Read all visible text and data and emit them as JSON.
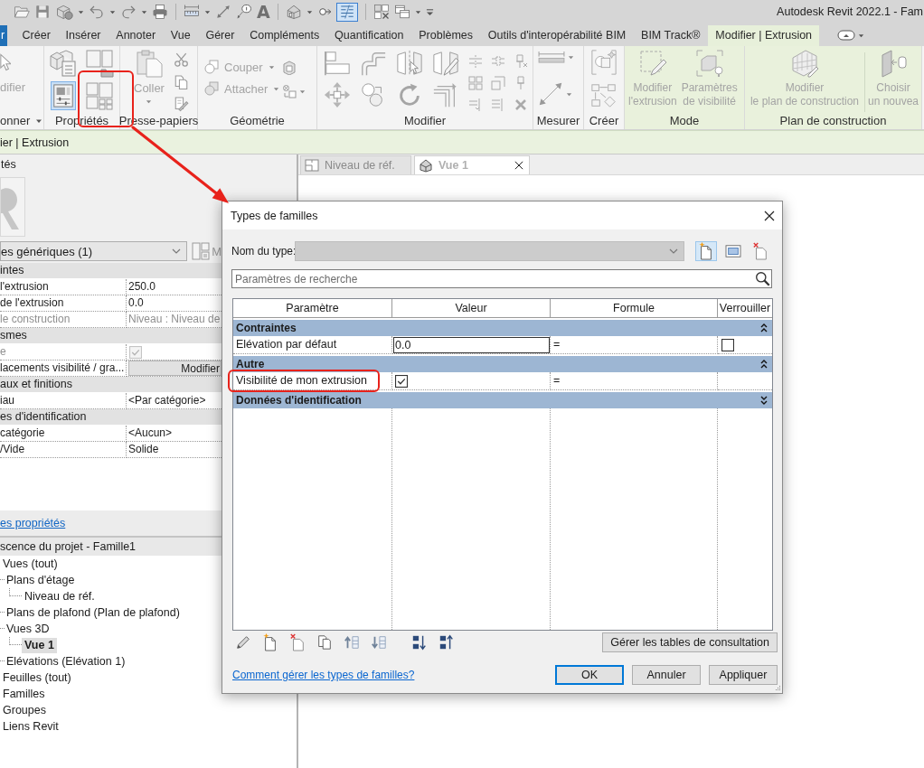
{
  "app_title": "Autodesk Revit 2022.1 - Fam",
  "quick_access": {
    "text_tool": "A",
    "thin_lines_on": true
  },
  "ribbon_tabs": [
    {
      "label": "r",
      "kind": "file",
      "selected": false
    },
    {
      "label": "Créer",
      "kind": "tab",
      "selected": false
    },
    {
      "label": "Insérer",
      "kind": "tab",
      "selected": false
    },
    {
      "label": "Annoter",
      "kind": "tab",
      "selected": false
    },
    {
      "label": "Vue",
      "kind": "tab",
      "selected": false
    },
    {
      "label": "Gérer",
      "kind": "tab",
      "selected": false
    },
    {
      "label": "Compléments",
      "kind": "tab",
      "selected": false
    },
    {
      "label": "Quantification",
      "kind": "tab",
      "selected": false
    },
    {
      "label": "Problèmes",
      "kind": "tab",
      "selected": false
    },
    {
      "label": "Outils d'interopérabilité BIM",
      "kind": "tab",
      "selected": false
    },
    {
      "label": "BIM Track®",
      "kind": "tab",
      "selected": false
    },
    {
      "label": "Modifier | Extrusion",
      "kind": "contextual",
      "selected": true
    }
  ],
  "ribbon": {
    "panels": [
      {
        "label": "onner",
        "contextual": false,
        "buttons": [
          {
            "label": "difier",
            "disabled": true
          }
        ]
      },
      {
        "label": "Propriétés",
        "contextual": false,
        "palette_on": true
      },
      {
        "label": "Presse-papiers",
        "contextual": false,
        "buttons": [
          {
            "label": "Coller",
            "disabled": true
          }
        ]
      },
      {
        "label": "Géométrie",
        "contextual": false,
        "buttons": [
          {
            "label": "Couper",
            "disabled": true
          },
          {
            "label": "Attacher",
            "disabled": true
          }
        ]
      },
      {
        "label": "Modifier",
        "contextual": false
      },
      {
        "label": "Mesurer",
        "contextual": false
      },
      {
        "label": "Créer",
        "contextual": false
      },
      {
        "label": "Mode",
        "contextual": true,
        "buttons": [
          {
            "label": "Modifier\nl'extrusion",
            "disabled": true
          },
          {
            "label": "Paramètres\nde visibilité",
            "disabled": true
          }
        ]
      },
      {
        "label": "Plan de construction",
        "contextual": true,
        "buttons": [
          {
            "label": "Modifier\nle plan de construction",
            "disabled": true
          },
          {
            "label": "Choisir\nun nouvea",
            "disabled": true
          }
        ]
      }
    ]
  },
  "options_bar": {
    "text": "ier | Extrusion"
  },
  "properties": {
    "title": "tés",
    "type_selector": "es génériques (1)",
    "edit_type_label": "M",
    "groups": [
      {
        "label": "intes",
        "rows": [
          {
            "name": "l'extrusion",
            "kind": "text",
            "value": "250.0",
            "disabled": false
          },
          {
            "name": "de l'extrusion",
            "kind": "text",
            "value": "0.0",
            "disabled": false
          },
          {
            "name": "le construction",
            "kind": "text",
            "value": "Niveau : Niveau de",
            "disabled": true
          }
        ]
      },
      {
        "label": "smes",
        "rows": [
          {
            "name": "e",
            "kind": "check",
            "checked": true,
            "disabled": true
          },
          {
            "name": "lacements visibilité / gra...",
            "kind": "button",
            "value": "Modifier",
            "disabled": false
          }
        ]
      },
      {
        "label": "aux et finitions",
        "rows": [
          {
            "name": "iau",
            "kind": "text",
            "value": "<Par catégorie>",
            "disabled": false
          }
        ]
      },
      {
        "label": "es d'identification",
        "rows": [
          {
            "name": "catégorie",
            "kind": "text",
            "value": "<Aucun>",
            "disabled": false
          },
          {
            "name": "/Vide",
            "kind": "text",
            "value": "Solide",
            "disabled": false
          }
        ]
      }
    ],
    "help_link": "es propriétés"
  },
  "project_browser": {
    "title": "scence du projet - Famille1",
    "tree": [
      {
        "label": "Vues (tout)",
        "selected": false,
        "children": [
          {
            "label": "Plans d'étage",
            "selected": false,
            "children": [
              {
                "label": "Niveau de réf.",
                "selected": false
              }
            ]
          },
          {
            "label": "Plans de plafond (Plan de plafond)",
            "selected": false
          },
          {
            "label": "Vues 3D",
            "selected": false,
            "children": [
              {
                "label": "Vue 1",
                "selected": true
              }
            ]
          },
          {
            "label": "Elévations (Elévation 1)",
            "selected": false
          }
        ]
      },
      {
        "label": "Feuilles (tout)",
        "selected": false
      },
      {
        "label": "Familles",
        "selected": false
      },
      {
        "label": "Groupes",
        "selected": false
      },
      {
        "label": "Liens Revit",
        "selected": false
      }
    ]
  },
  "view_tabs": [
    {
      "label": "Niveau de réf.",
      "kind": "plan",
      "selected": false
    },
    {
      "label": "Vue 1",
      "kind": "perspective",
      "selected": true
    }
  ],
  "dialog": {
    "title": "Types de familles",
    "type_name_label": "Nom du type:",
    "type_name_field": {
      "disabled": true
    },
    "search_placeholder": "Paramètres de recherche",
    "columns": [
      "Paramètre",
      "Valeur",
      "Formule",
      "Verrouiller"
    ],
    "groups": [
      {
        "label": "Contraintes",
        "expanded": true,
        "rows": [
          {
            "parameter": "Elévation par défaut",
            "kind": "number",
            "value": "0.0",
            "formula": "=",
            "locked": false
          }
        ]
      },
      {
        "label": "Autre",
        "expanded": true,
        "rows": [
          {
            "parameter": "Visibilité de mon extrusion",
            "kind": "check",
            "checked": true,
            "formula": "="
          }
        ]
      },
      {
        "label": "Données d'identification",
        "expanded": false
      }
    ],
    "manage_button": "Gérer les tables de consultation",
    "help_link": "Comment gérer les types de familles?",
    "buttons": [
      {
        "label": "OK",
        "default": true
      },
      {
        "label": "Annuler",
        "default": false
      },
      {
        "label": "Appliquer",
        "default": false
      }
    ]
  }
}
